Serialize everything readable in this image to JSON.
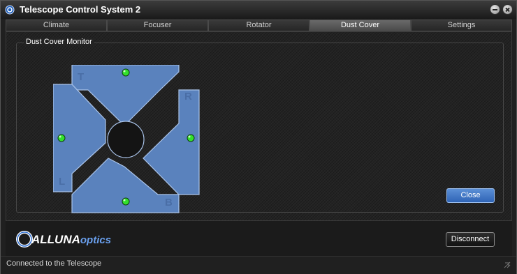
{
  "window": {
    "title": "Telescope Control System 2"
  },
  "tabs": [
    {
      "label": "Climate",
      "active": false
    },
    {
      "label": "Focuser",
      "active": false
    },
    {
      "label": "Rotator",
      "active": false
    },
    {
      "label": "Dust Cover",
      "active": true
    },
    {
      "label": "Settings",
      "active": false
    }
  ],
  "panel": {
    "title": "Dust Cover Monitor",
    "petal_labels": {
      "top": "T",
      "right": "R",
      "left": "L",
      "bottom": "B"
    },
    "petal_color": "#5a82bd",
    "indicator_color": "#33e02c",
    "close_label": "Close"
  },
  "footer": {
    "logo_main": "ALLUNA",
    "logo_sub": "optics",
    "disconnect_label": "Disconnect"
  },
  "status": {
    "text": "Connected to the Telescope"
  }
}
